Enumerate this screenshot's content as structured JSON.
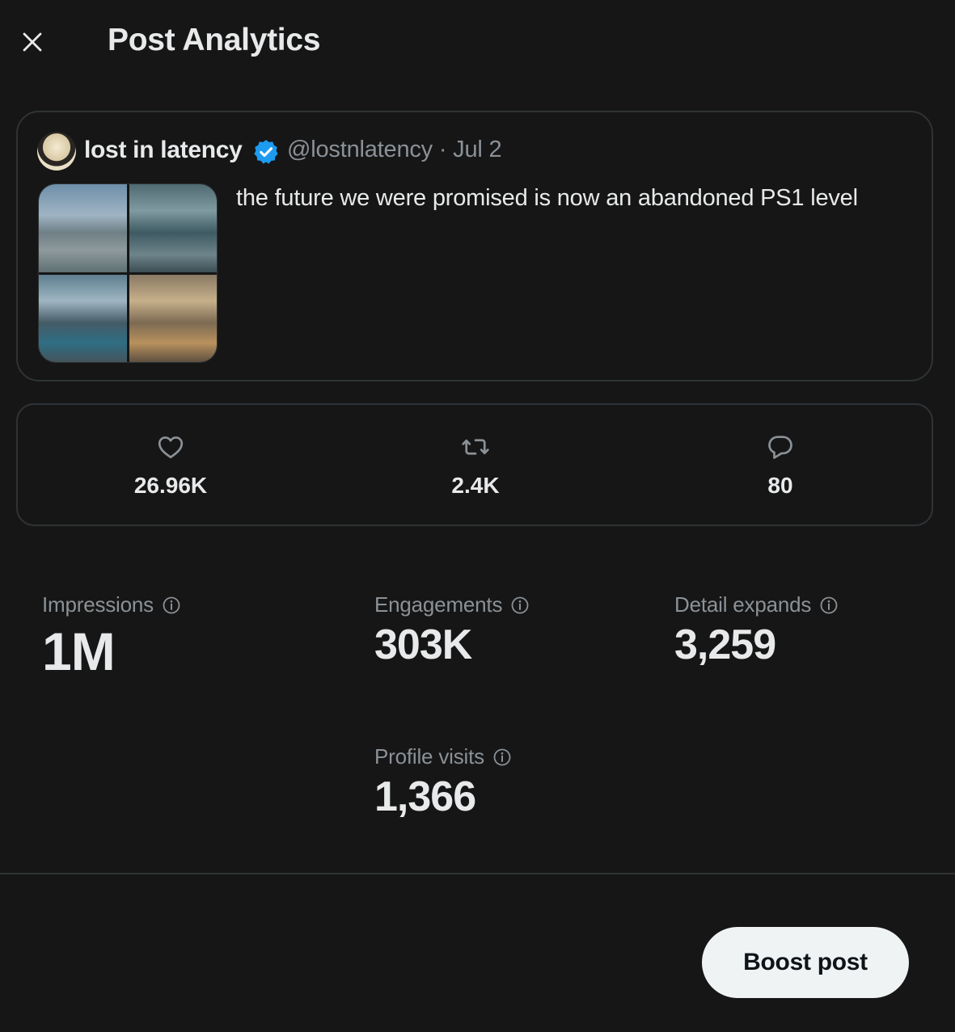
{
  "header": {
    "title": "Post Analytics",
    "close_icon": "close-icon"
  },
  "post": {
    "author_name": "lost in latency",
    "verified_icon": "verified-badge-icon",
    "meta": "@lostnlatency · Jul 2",
    "text": "the future we were promised is now an abandoned PS1 level",
    "media_count": 4
  },
  "engagement_summary": {
    "likes": {
      "icon": "heart-icon",
      "value": "26.96K"
    },
    "reposts": {
      "icon": "repost-icon",
      "value": "2.4K"
    },
    "replies": {
      "icon": "reply-icon",
      "value": "80"
    }
  },
  "metrics": {
    "impressions": {
      "label": "Impressions",
      "value": "1M"
    },
    "engagements": {
      "label": "Engagements",
      "value": "303K"
    },
    "detail_expands": {
      "label": "Detail expands",
      "value": "3,259"
    },
    "profile_visits": {
      "label": "Profile visits",
      "value": "1,366"
    }
  },
  "footer": {
    "boost_label": "Boost post"
  },
  "colors": {
    "background": "#161616",
    "border": "#2f3336",
    "text_primary": "#e7e9ea",
    "text_secondary": "#8b9196",
    "verified_blue": "#1d9bf0",
    "button_bg": "#eff3f4"
  }
}
